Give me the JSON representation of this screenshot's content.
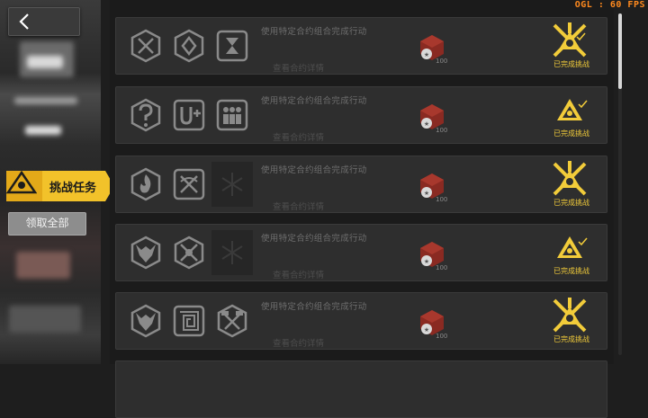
{
  "fps_overlay": "OGL : 60 FPS",
  "sidebar": {
    "active_tab_label": "挑战任务",
    "claim_all_label": "领取全部"
  },
  "contracts": [
    {
      "title": "使用特定合约组合完成行动",
      "detail_link": "查看合约详情",
      "reward_count": "100",
      "status": "已完成挑战",
      "icons": [
        "crossed-swords-icon",
        "cube-icon",
        "hourglass-icon"
      ]
    },
    {
      "title": "使用特定合约组合完成行动",
      "detail_link": "查看合约详情",
      "reward_count": "100",
      "status": "已完成挑战",
      "icons": [
        "question-mark-icon",
        "magnet-plus-icon",
        "crowd-icon"
      ]
    },
    {
      "title": "使用特定合约组合完成行动",
      "detail_link": "查看合约详情",
      "reward_count": "100",
      "status": "已完成挑战",
      "icons": [
        "flame-shield-icon",
        "crossed-bows-icon",
        "empty-slot-icon"
      ]
    },
    {
      "title": "使用特定合约组合完成行动",
      "detail_link": "查看合约详情",
      "reward_count": "100",
      "status": "已完成挑战",
      "icons": [
        "beast-skull-icon",
        "crossed-blades-icon",
        "empty-slot-icon"
      ]
    },
    {
      "title": "使用特定合约组合完成行动",
      "detail_link": "查看合约详情",
      "reward_count": "100",
      "status": "已完成挑战",
      "icons": [
        "beast-skull-icon",
        "maze-icon",
        "crossed-hammers-icon"
      ]
    }
  ],
  "colors": {
    "accent_gold": "#f2cc3a",
    "fps_orange": "#ff8a1e",
    "reward_red": "#8a2a22"
  }
}
